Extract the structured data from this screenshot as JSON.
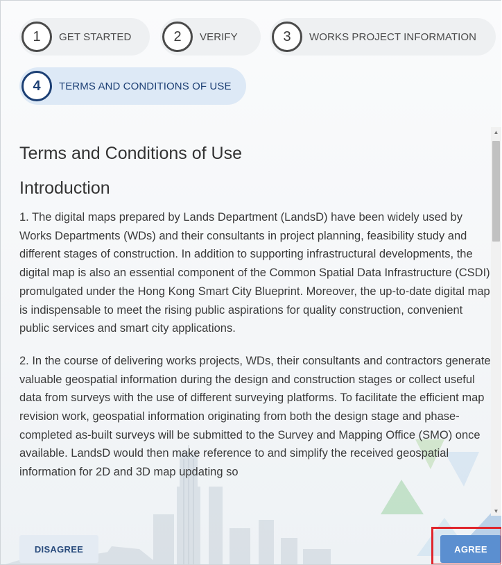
{
  "steps": [
    {
      "number": "1",
      "label": "GET STARTED"
    },
    {
      "number": "2",
      "label": "VERIFY"
    },
    {
      "number": "3",
      "label": "WORKS PROJECT INFORMATION"
    },
    {
      "number": "4",
      "label": "TERMS AND CONDITIONS OF USE"
    }
  ],
  "content": {
    "title": "Terms and Conditions of Use",
    "subtitle": "Introduction",
    "paragraphs": [
      "1. The digital maps prepared by Lands Department (LandsD) have been widely used by Works Departments (WDs) and their consultants in project planning, feasibility study and different stages of construction. In addition to supporting infrastructural developments, the digital map is also an essential component of the Common Spatial Data Infrastructure (CSDI) promulgated under the Hong Kong Smart City Blueprint. Moreover, the up-to-date digital map is indispensable to meet the rising public aspirations for quality construction, convenient public services and smart city applications.",
      "2. In the course of delivering works projects, WDs, their consultants and contractors generate valuable geospatial information during the design and construction stages or collect useful data from surveys with the use of different surveying platforms. To facilitate the efficient map revision work, geospatial information originating from both the design stage and phase-completed as-built surveys will be submitted to the Survey and Mapping Office (SMO) once available. LandsD would then make reference to and simplify the received geospatial information for 2D and 3D map updating so"
    ]
  },
  "buttons": {
    "disagree": "DISAGREE",
    "agree": "AGREE"
  },
  "colors": {
    "active_step": "#1c3f74",
    "active_step_bg": "#dde9f6",
    "agree_bg": "#5b8fd0",
    "disagree_bg": "#e4ebf3",
    "highlight": "#e0262d"
  },
  "icons": {
    "scroll_up": "triangle-up",
    "scroll_down": "triangle-down"
  }
}
